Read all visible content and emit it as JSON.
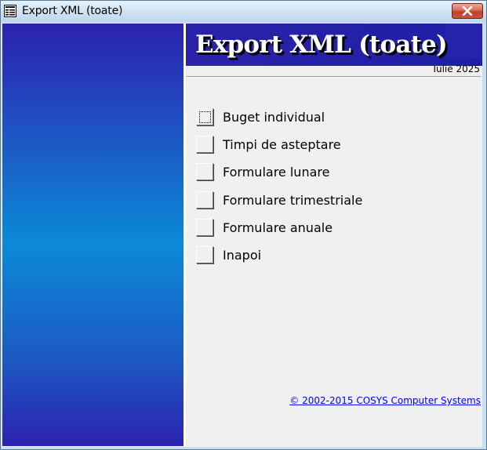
{
  "window": {
    "title": "Export XML (toate)",
    "app_icon": "form-icon",
    "close_icon": "close-icon"
  },
  "form": {
    "title": "Export XML (toate)",
    "date": "Iulie 2025"
  },
  "menu": {
    "items": [
      {
        "label": "Buget individual",
        "focused": true
      },
      {
        "label": "Timpi de asteptare",
        "focused": false
      },
      {
        "label": "Formulare lunare",
        "focused": false
      },
      {
        "label": "Formulare trimestriale",
        "focused": false
      },
      {
        "label": "Formulare anuale",
        "focused": false
      },
      {
        "label": "Inapoi",
        "focused": false
      }
    ]
  },
  "footer": {
    "copyright": "© 2002-2015 COSYS Computer Systems"
  },
  "colors": {
    "header_band": "#2421a7",
    "side_gradient_top": "#2b22b0",
    "side_gradient_mid": "#0b8ad8",
    "link": "#0000ee",
    "close_button": "#c0402a"
  }
}
